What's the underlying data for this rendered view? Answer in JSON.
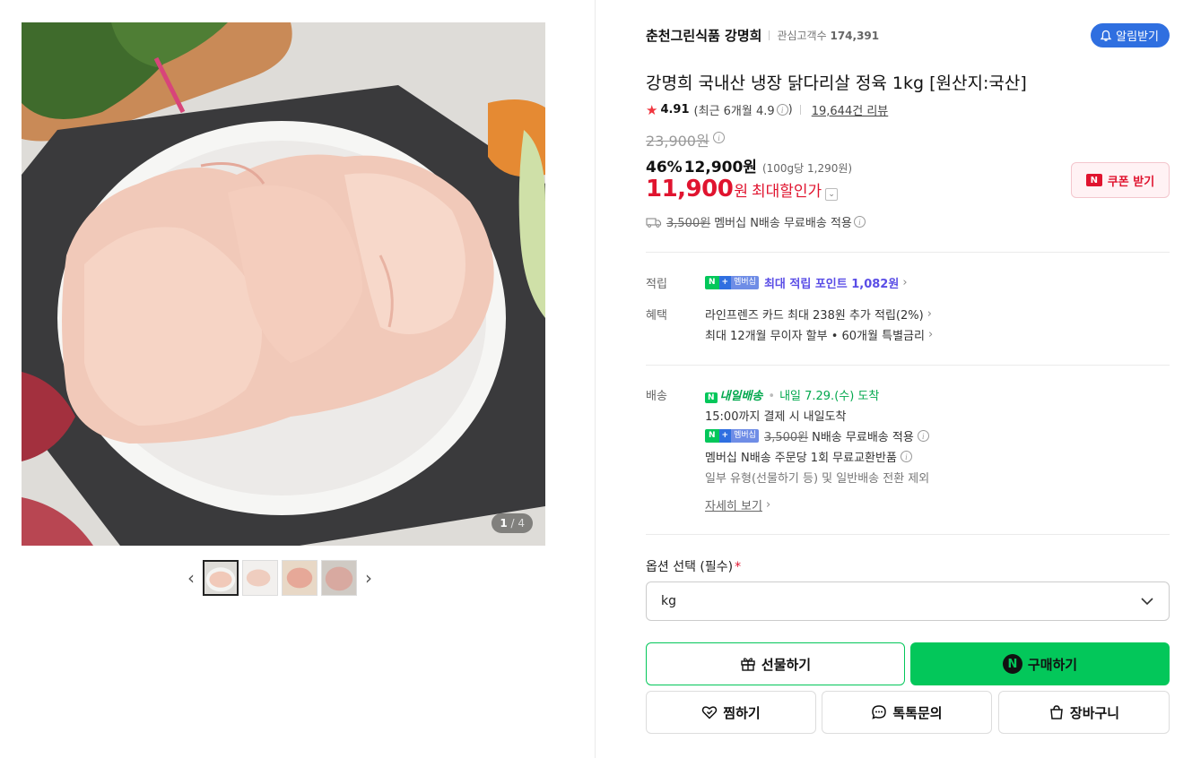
{
  "gallery": {
    "counter_current": "1",
    "counter_total": "4",
    "thumbnails": [
      "thumb-1",
      "thumb-2",
      "thumb-3",
      "thumb-4"
    ]
  },
  "store": {
    "name": "춘천그린식품 강명희",
    "fans_label": "관심고객수",
    "fans_count": "174,391",
    "alarm_label": "알림받기"
  },
  "product": {
    "title": "강명희 국내산 냉장 닭다리살 정육 1kg [원산지:국산]",
    "rating": "4.91",
    "rating_recent": "(최근 6개월 4.9",
    "rating_close": ")",
    "review_link": "19,644건 리뷰",
    "original_price": "23,900원",
    "discount": "46%",
    "sale_price": "12,900원",
    "unit_price": "(100g당 1,290원)",
    "max_price_num": "11,900",
    "max_price_unit": "원",
    "max_label": "최대할인가",
    "coupon_label": "쿠폰 받기",
    "coupon_badge": "N",
    "shipping_strike": "3,500원",
    "shipping_text": "멤버십 N배송 무료배송 적용"
  },
  "benefits": {
    "points_label": "적립",
    "points_text": "최대 적립 포인트 1,082원",
    "badge_n": "N",
    "badge_plus": "+",
    "badge_member": "멤버십",
    "benefit_label": "혜택",
    "benefit_1": "라인프렌즈 카드 최대 238원 추가 적립(2%)",
    "benefit_2": "최대 12개월 무이자 할부 • 60개월 특별금리"
  },
  "delivery": {
    "label": "배송",
    "nextday_icon": "N",
    "nextday_label": "내일배송",
    "arrive": "내일 7.29.(수) 도착",
    "arrive_dot": "•",
    "cutoff": "15:00까지 결제 시 내일도착",
    "free_strike": "3,500원",
    "free_text": "N배송 무료배송 적용",
    "exchange": "멤버십 N배송 주문당 1회 무료교환반품",
    "exclude": "일부 유형(선물하기 등) 및 일반배송 전환 제외",
    "detail_link": "자세히 보기"
  },
  "options": {
    "title": "옵션 선택 (필수)",
    "required_mark": "*",
    "selected": "kg"
  },
  "actions": {
    "gift": "선물하기",
    "buy": "구매하기",
    "buy_badge": "N",
    "wish": "찜하기",
    "talk": "톡톡문의",
    "cart": "장바구니"
  },
  "colors": {
    "naver_green": "#03c75a",
    "sale_red": "#e0142f",
    "alarm_blue": "#2f6fe0",
    "point_purple": "#5a4de6"
  }
}
